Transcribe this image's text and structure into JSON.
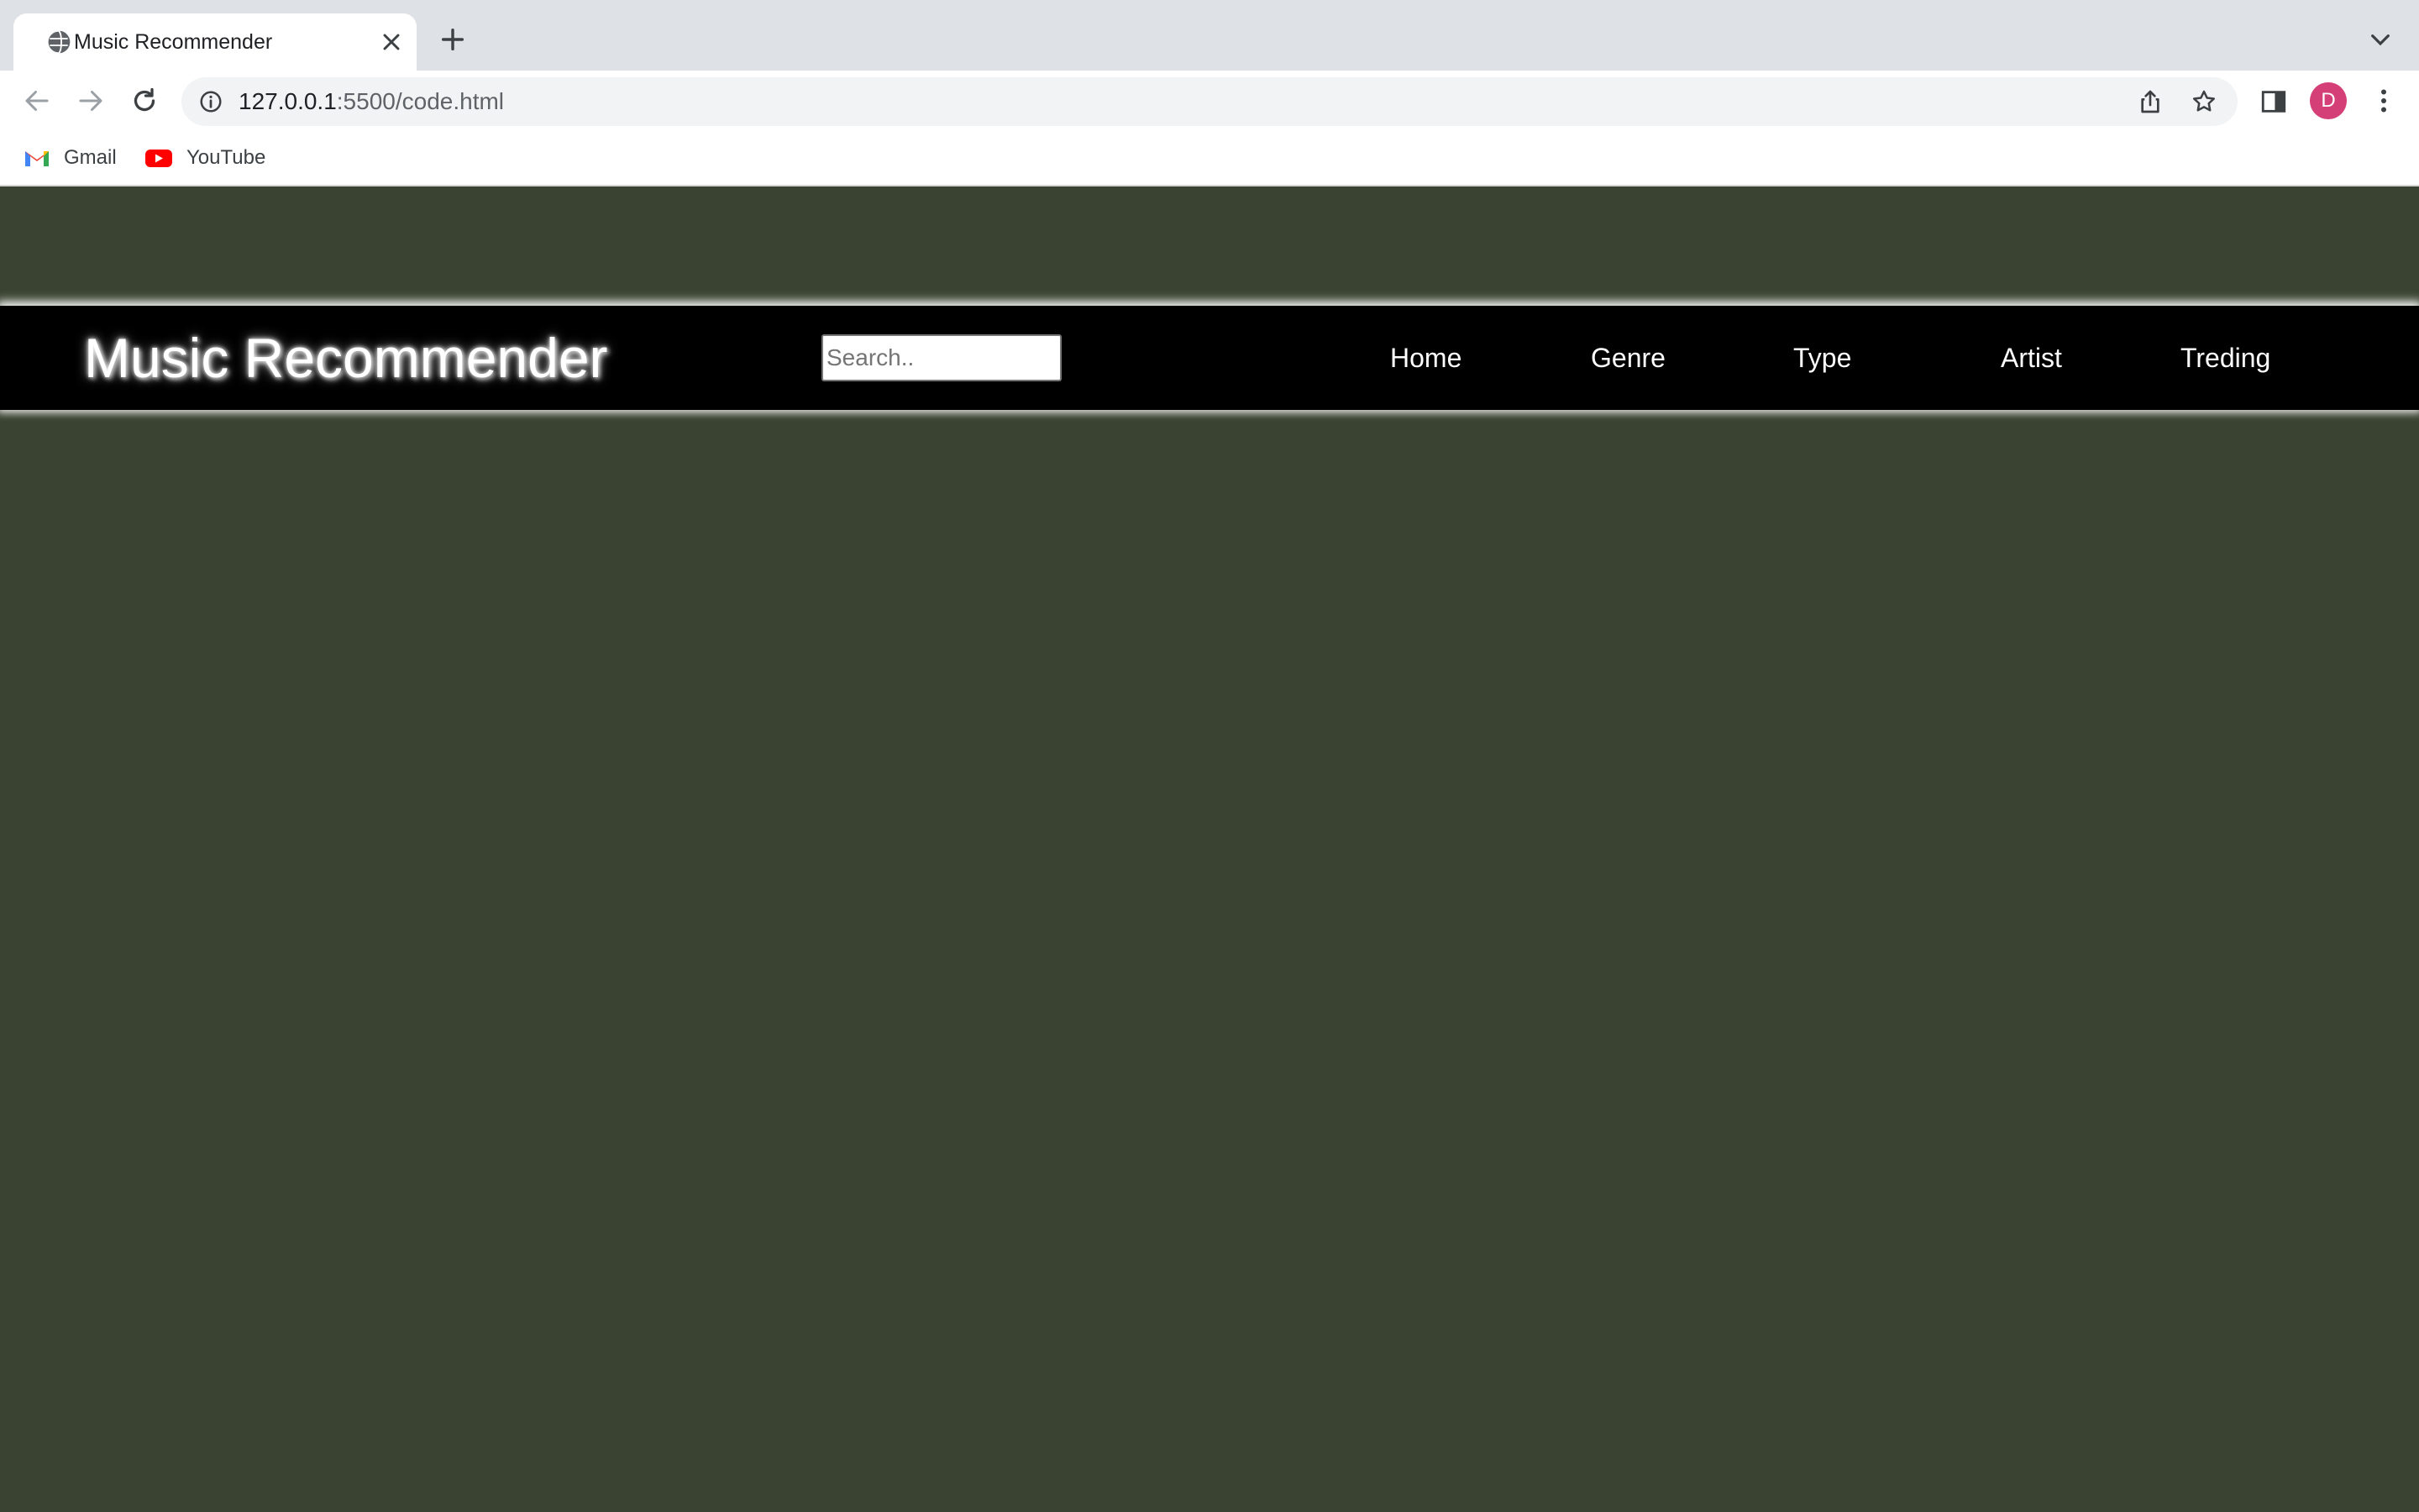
{
  "browser": {
    "tab": {
      "title": "Music Recommender",
      "icon": "globe-icon"
    },
    "address_bar": {
      "host": "127.0.0.1",
      "rest": ":5500/code.html"
    },
    "profile_initial": "D",
    "bookmarks": [
      {
        "label": "Gmail",
        "icon": "gmail-icon"
      },
      {
        "label": "YouTube",
        "icon": "youtube-icon"
      }
    ]
  },
  "site": {
    "brand": "Music Recommender",
    "search": {
      "placeholder": "Search..",
      "value": ""
    },
    "nav": [
      {
        "label": "Home"
      },
      {
        "label": "Genre"
      },
      {
        "label": "Type"
      },
      {
        "label": "Artist"
      },
      {
        "label": "Treding"
      }
    ]
  },
  "colors": {
    "page_background": "#3a4331",
    "navbar_background": "#000000",
    "nav_text": "#ffffff",
    "avatar": "#d33f76"
  }
}
